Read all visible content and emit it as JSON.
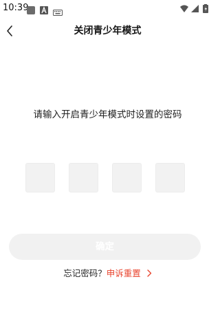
{
  "status_bar": {
    "time": "10:39"
  },
  "header": {
    "title": "关闭青少年模式"
  },
  "prompt": {
    "text": "请输入开启青少年模式时设置的密码"
  },
  "pin": {
    "digits": [
      "",
      "",
      "",
      ""
    ]
  },
  "confirm": {
    "label": "确定"
  },
  "footer": {
    "forgot_text": "忘记密码？",
    "appeal_link": "申诉重置"
  },
  "colors": {
    "accent": "#e8442e",
    "pin_box": "#f2f2f2",
    "button_disabled": "#f1f1f1"
  }
}
